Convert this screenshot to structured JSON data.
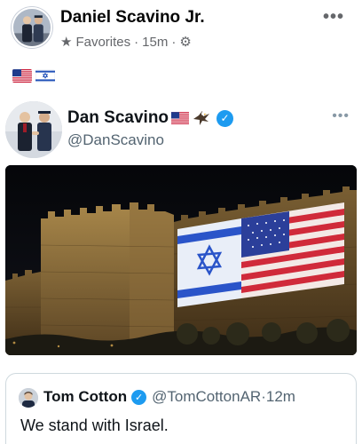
{
  "post": {
    "author": "Daniel Scavino Jr.",
    "audience": "Favorites",
    "time": "15m",
    "separator": "·",
    "more_label": "•••",
    "text_emoji": [
      "us-flag",
      "israel-flag"
    ]
  },
  "tweet": {
    "name": "Dan Scavino",
    "handle": "@DanScavino",
    "more_label": "•••",
    "name_emoji": [
      "us-flag",
      "eagle"
    ],
    "photo_description": "Jerusalem walls illuminated with Israeli and US flags"
  },
  "quote": {
    "name": "Tom Cotton",
    "handle": "@TomCottonAR",
    "time": "12m",
    "text": "We stand with Israel."
  },
  "colors": {
    "verified": "#1d9bf0",
    "meta_gray": "#65676b",
    "handle_gray": "#536471"
  }
}
